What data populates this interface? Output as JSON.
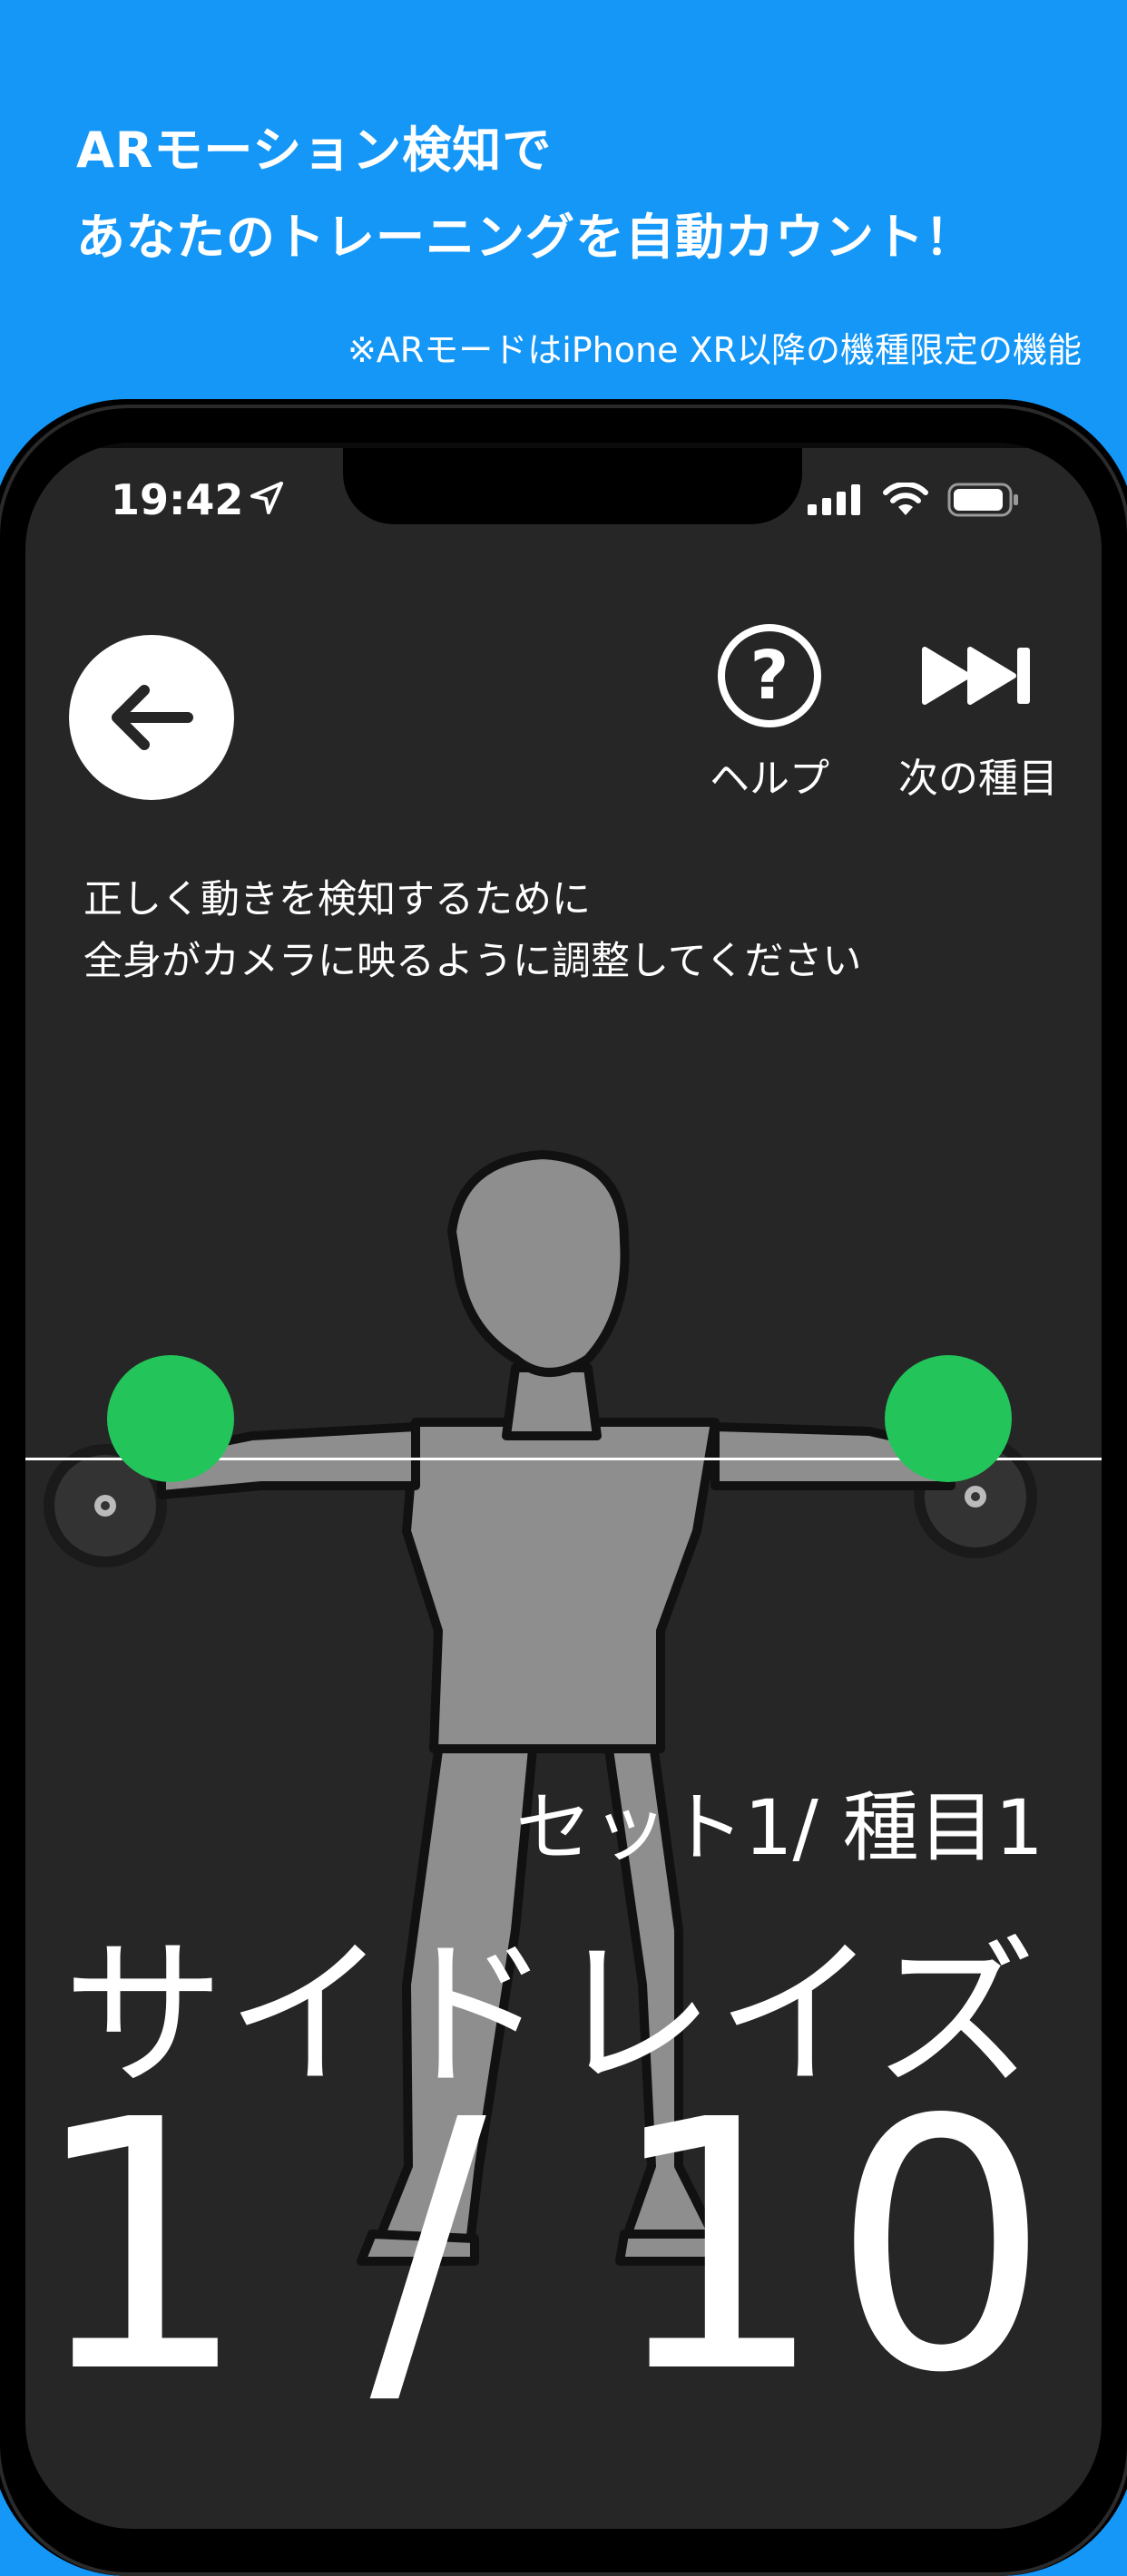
{
  "promo": {
    "headline_line1": "ARモーション検知で",
    "headline_line2": "あなたのトレーニングを自動カウント！",
    "note": "※ARモードはiPhone XR以降の機種限定の機能"
  },
  "status_bar": {
    "time": "19:42",
    "icons": [
      "location-arrow-icon",
      "cellular-signal-icon",
      "wifi-icon",
      "battery-icon"
    ]
  },
  "toolbar": {
    "back_icon": "arrow-left-icon",
    "help_label": "ヘルプ",
    "next_label": "次の種目"
  },
  "instruction": {
    "line1": "正しく動きを検知するために",
    "line2": "全身がカメラに映るように調整してください"
  },
  "workout": {
    "set_info": "セット1/ 種目1",
    "exercise_name": "サイドレイズ",
    "rep_count": "1 / 10"
  },
  "colors": {
    "promo_background": "#1497f7",
    "screen_background": "#262626",
    "marker": "#23c55b",
    "figure": "#8e8e8e"
  }
}
